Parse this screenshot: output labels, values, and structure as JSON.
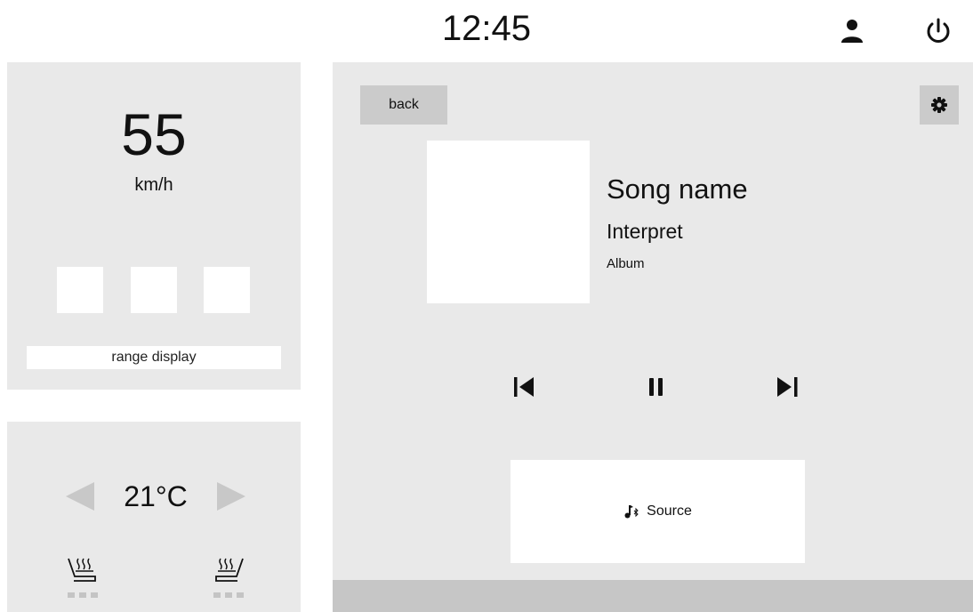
{
  "status_bar": {
    "time": "12:45",
    "user_icon": "person-icon",
    "power_icon": "power-icon"
  },
  "speed_panel": {
    "speed": "55",
    "unit": "km/h",
    "range_label": "range display"
  },
  "climate": {
    "temperature": "21°C",
    "decrease_icon": "triangle-left-icon",
    "increase_icon": "triangle-right-icon",
    "left_seat_icon": "seat-heater-icon",
    "right_seat_icon": "seat-heater-icon"
  },
  "media": {
    "back_label": "back",
    "settings_icon": "gear-icon",
    "song_name": "Song name",
    "interpret": "Interpret",
    "album": "Album",
    "controls": [
      "previous-track-icon",
      "pause-icon",
      "next-track-icon"
    ],
    "source_label": "Source",
    "source_icon": "bluetooth-music-icon"
  },
  "colors": {
    "panel_bg": "#e9e9e9",
    "button_bg": "#cbcbcb",
    "bottom_bar": "#c6c6c6",
    "arrow": "#c8c8c8"
  }
}
